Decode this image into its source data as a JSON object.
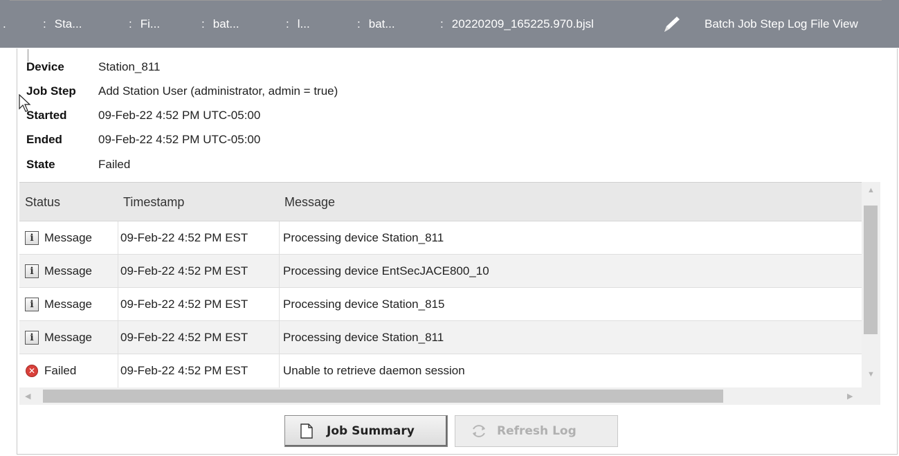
{
  "breadcrumb": {
    "items": [
      {
        "sep": ".",
        "label": ""
      },
      {
        "sep": ":",
        "label": "Sta..."
      },
      {
        "sep": ":",
        "label": "Fi..."
      },
      {
        "sep": ":",
        "label": "bat..."
      },
      {
        "sep": ":",
        "label": "l..."
      },
      {
        "sep": ":",
        "label": "bat..."
      },
      {
        "sep": ":",
        "label": "20220209_165225.970.bjsl"
      }
    ],
    "edit_icon": "pencil-icon",
    "view_label": "Batch Job Step Log File View"
  },
  "details": {
    "device": {
      "label": "Device",
      "value": "Station_811"
    },
    "job_step": {
      "label": "Job Step",
      "value": "Add Station User (administrator, admin = true)"
    },
    "started": {
      "label": "Started",
      "value": "09-Feb-22 4:52 PM UTC-05:00"
    },
    "ended": {
      "label": "Ended",
      "value": "09-Feb-22 4:52 PM UTC-05:00"
    },
    "state": {
      "label": "State",
      "value": "Failed"
    }
  },
  "table": {
    "columns": [
      "Status",
      "Timestamp",
      "Message"
    ],
    "rows": [
      {
        "icon": "info-icon",
        "status": "Message",
        "timestamp": "09-Feb-22 4:52 PM EST",
        "message": "Processing device Station_811"
      },
      {
        "icon": "info-icon",
        "status": "Message",
        "timestamp": "09-Feb-22 4:52 PM EST",
        "message": "Processing device EntSecJACE800_10"
      },
      {
        "icon": "info-icon",
        "status": "Message",
        "timestamp": "09-Feb-22 4:52 PM EST",
        "message": "Processing device Station_815"
      },
      {
        "icon": "info-icon",
        "status": "Message",
        "timestamp": "09-Feb-22 4:52 PM EST",
        "message": "Processing device Station_811"
      },
      {
        "icon": "failed-icon",
        "status": "Failed",
        "timestamp": "09-Feb-22 4:52 PM EST",
        "message": "Unable to retrieve daemon session"
      }
    ]
  },
  "buttons": {
    "job_summary": {
      "label": "Job Summary",
      "icon": "document-icon"
    },
    "refresh_log": {
      "label": "Refresh Log",
      "icon": "refresh-icon"
    }
  },
  "colors": {
    "breadcrumb_bg": "#838891",
    "failed": "#d9403a"
  }
}
